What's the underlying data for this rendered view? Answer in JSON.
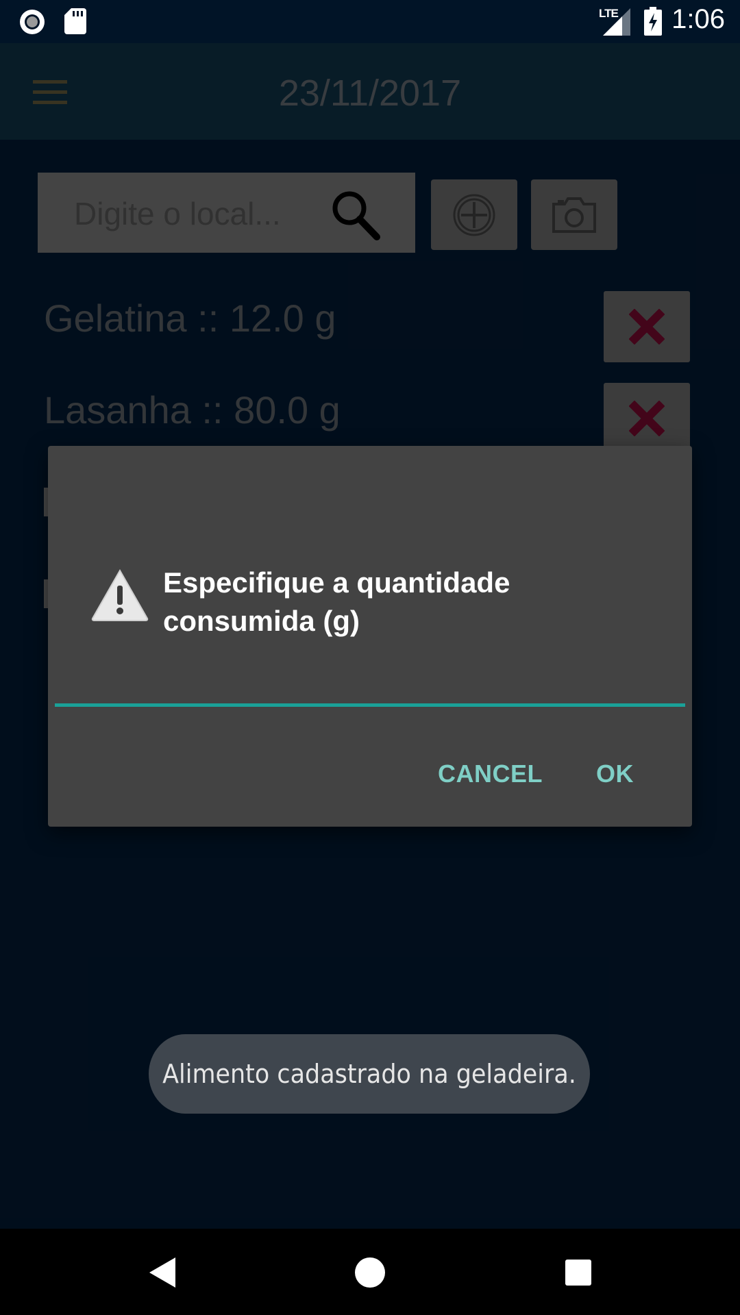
{
  "status_bar": {
    "time": "1:06",
    "network_label": "LTE",
    "icons": [
      "record-icon",
      "sd-card-icon",
      "signal-icon",
      "battery-charging-icon"
    ]
  },
  "app_bar": {
    "title": "23/11/2017",
    "menu_icon": "hamburger-menu-icon",
    "title_color": "#666e75"
  },
  "search": {
    "placeholder": "Digite o local...",
    "value": "",
    "icon": "search-icon"
  },
  "actions": {
    "add_icon": "add-circle-icon",
    "camera_icon": "camera-icon"
  },
  "food_list": [
    {
      "label": "Gelatina :: 12.0 g",
      "delete_icon": "delete-x-icon"
    },
    {
      "label": "Lasanha :: 80.0 g",
      "delete_icon": "delete-x-icon"
    }
  ],
  "dialog": {
    "icon": "warning-icon",
    "title": "Especifique a quantidade consumida (g)",
    "input_value": "",
    "cancel_label": "CANCEL",
    "ok_label": "OK",
    "accent_color": "#1aa198"
  },
  "toast": {
    "message": "Alimento cadastrado na geladeira."
  },
  "nav_bar": {
    "back_icon": "back-triangle-icon",
    "home_icon": "home-circle-icon",
    "recents_icon": "recents-square-icon"
  },
  "colors": {
    "background": "#031a33",
    "app_bar": "#0f3347",
    "delete_x": "#7a0a30",
    "dialog_button": "#7fcfc6"
  }
}
